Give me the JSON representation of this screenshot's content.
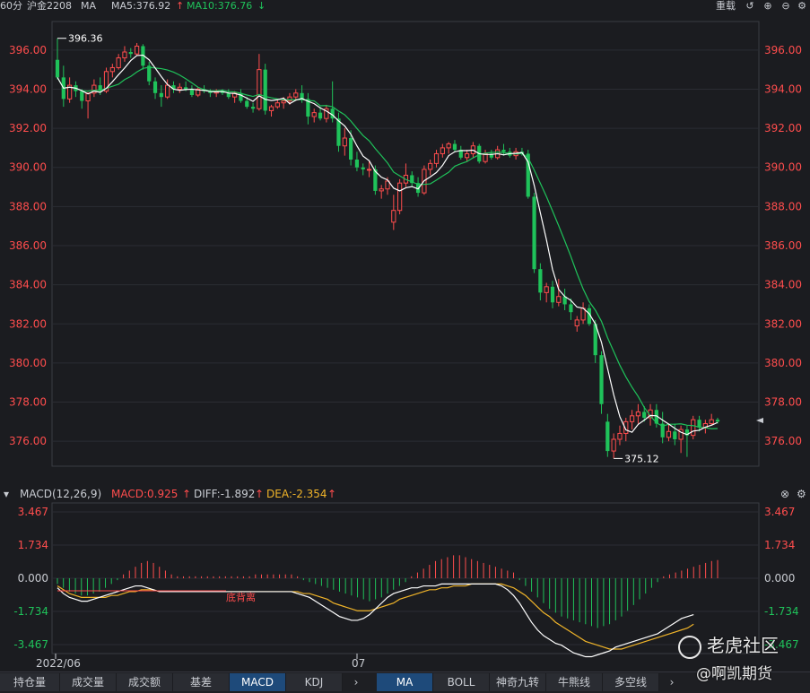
{
  "header": {
    "interval": "60分",
    "symbol": "沪金2208",
    "indicator": "MA",
    "ma5": "MA5:376.92",
    "ma10": "MA10:376.76",
    "reset_label": "重载"
  },
  "price_axis": [
    "396.00",
    "394.00",
    "392.00",
    "390.00",
    "388.00",
    "386.00",
    "384.00",
    "382.00",
    "380.00",
    "378.00",
    "376.00"
  ],
  "annotations": {
    "high": "396.36",
    "low": "375.12"
  },
  "macd_header": {
    "name": "MACD(12,26,9)",
    "macd": "MACD:0.925",
    "diff": "DIFF:-1.892",
    "dea": "DEA:-2.354"
  },
  "macd_axis": [
    "3.467",
    "1.734",
    "0.000",
    "-1.734",
    "-3.467"
  ],
  "macd_annotation": "底背离",
  "time_axis": [
    "2022/06",
    "07"
  ],
  "tabs_left": [
    "持仓量",
    "成交量",
    "成交额",
    "基差",
    "MACD",
    "KDJ"
  ],
  "tabs_right": [
    "MA",
    "BOLL",
    "神奇九转",
    "牛熊线",
    "多空线"
  ],
  "active_left": "MACD",
  "active_right": "MA",
  "watermark": {
    "brand": "老虎社区",
    "weibo": "@啊凯期货"
  },
  "colors": {
    "up": "#ff4d4d",
    "down": "#1fc25a",
    "ma5": "#ffffff",
    "ma10": "#1fc25a",
    "dea": "#f0b429",
    "accent": "#1e4a7a"
  },
  "chart_data": [
    {
      "type": "candlestick",
      "title": "沪金2208 60分",
      "ylim": [
        375.0,
        397.0
      ],
      "grid": true,
      "series": [
        {
          "name": "candles",
          "values": [
            [
              395.5,
              396.6,
              394.5,
              394.6
            ],
            [
              394.6,
              395.2,
              393.1,
              393.5
            ],
            [
              393.5,
              394.6,
              393.3,
              394.2
            ],
            [
              394.2,
              394.4,
              393.6,
              393.9
            ],
            [
              393.9,
              394.0,
              393.0,
              393.4
            ],
            [
              393.4,
              393.8,
              392.5,
              393.8
            ],
            [
              393.8,
              394.5,
              393.6,
              394.2
            ],
            [
              394.2,
              394.6,
              393.7,
              393.9
            ],
            [
              393.9,
              395.1,
              393.8,
              394.9
            ],
            [
              394.9,
              395.3,
              394.6,
              395.1
            ],
            [
              395.1,
              395.8,
              395.0,
              395.6
            ],
            [
              395.6,
              396.2,
              395.4,
              395.9
            ],
            [
              395.9,
              396.1,
              395.6,
              395.8
            ],
            [
              395.8,
              396.36,
              395.7,
              396.2
            ],
            [
              396.2,
              396.3,
              395.0,
              395.2
            ],
            [
              395.2,
              395.4,
              394.2,
              394.4
            ],
            [
              394.4,
              394.6,
              393.5,
              393.8
            ],
            [
              393.8,
              394.2,
              393.1,
              393.6
            ],
            [
              393.6,
              394.5,
              393.5,
              394.2
            ],
            [
              394.2,
              394.4,
              393.8,
              394.0
            ],
            [
              394.0,
              394.3,
              393.8,
              394.1
            ],
            [
              394.1,
              394.4,
              393.9,
              394.0
            ],
            [
              394.0,
              394.2,
              393.6,
              393.7
            ],
            [
              393.7,
              394.1,
              393.6,
              394.0
            ],
            [
              394.0,
              394.2,
              393.8,
              393.9
            ],
            [
              393.9,
              394.0,
              393.6,
              393.8
            ],
            [
              393.8,
              394.0,
              393.6,
              393.9
            ],
            [
              393.9,
              394.0,
              393.7,
              393.8
            ],
            [
              393.8,
              394.0,
              393.5,
              393.6
            ],
            [
              393.6,
              393.9,
              393.3,
              393.8
            ],
            [
              393.8,
              394.0,
              393.3,
              393.4
            ],
            [
              393.4,
              393.6,
              393.0,
              393.1
            ],
            [
              393.1,
              393.3,
              392.8,
              393.0
            ],
            [
              393.0,
              395.8,
              392.9,
              395.0
            ],
            [
              395.0,
              395.3,
              392.7,
              392.9
            ],
            [
              392.9,
              393.2,
              392.6,
              393.1
            ],
            [
              393.1,
              393.5,
              393.0,
              393.3
            ],
            [
              393.3,
              393.6,
              393.0,
              393.4
            ],
            [
              393.4,
              393.8,
              393.2,
              393.6
            ],
            [
              393.6,
              394.0,
              393.4,
              393.8
            ],
            [
              393.8,
              394.2,
              393.3,
              393.5
            ],
            [
              393.5,
              393.8,
              392.2,
              392.6
            ],
            [
              392.6,
              393.0,
              392.3,
              392.8
            ],
            [
              392.8,
              393.1,
              392.4,
              392.5
            ],
            [
              392.5,
              393.2,
              392.3,
              393.0
            ],
            [
              393.0,
              394.4,
              392.3,
              392.5
            ],
            [
              392.5,
              392.8,
              390.8,
              391.1
            ],
            [
              391.1,
              392.0,
              390.6,
              391.5
            ],
            [
              391.5,
              391.9,
              390.1,
              390.4
            ],
            [
              390.4,
              390.8,
              389.8,
              390.0
            ],
            [
              390.0,
              390.2,
              389.6,
              389.9
            ],
            [
              389.9,
              390.3,
              389.5,
              389.9
            ],
            [
              389.9,
              390.1,
              388.6,
              388.8
            ],
            [
              388.8,
              389.1,
              388.4,
              388.9
            ],
            [
              388.9,
              389.5,
              388.6,
              389.3
            ],
            [
              387.2,
              388.6,
              386.8,
              387.8
            ],
            [
              387.8,
              389.4,
              387.6,
              389.2
            ],
            [
              389.2,
              390.2,
              389.0,
              389.6
            ],
            [
              389.6,
              389.8,
              389.0,
              389.2
            ],
            [
              389.2,
              389.5,
              388.5,
              388.7
            ],
            [
              388.7,
              390.1,
              388.6,
              389.9
            ],
            [
              389.9,
              390.4,
              389.6,
              390.2
            ],
            [
              390.2,
              390.9,
              390.0,
              390.7
            ],
            [
              390.7,
              391.2,
              390.5,
              391.0
            ],
            [
              391.0,
              391.3,
              390.7,
              391.2
            ],
            [
              391.2,
              391.4,
              390.8,
              390.9
            ],
            [
              390.9,
              391.1,
              390.4,
              390.5
            ],
            [
              390.5,
              390.9,
              390.3,
              390.7
            ],
            [
              390.7,
              391.3,
              390.5,
              391.1
            ],
            [
              391.1,
              391.2,
              390.2,
              390.3
            ],
            [
              390.3,
              390.9,
              390.2,
              390.7
            ],
            [
              390.7,
              390.9,
              390.4,
              390.5
            ],
            [
              390.5,
              391.1,
              390.4,
              390.9
            ],
            [
              390.9,
              391.2,
              390.6,
              390.8
            ],
            [
              390.8,
              391.0,
              390.5,
              390.6
            ],
            [
              390.6,
              391.0,
              390.4,
              390.8
            ],
            [
              390.8,
              391.0,
              390.6,
              390.7
            ],
            [
              390.7,
              390.9,
              388.4,
              388.5
            ],
            [
              388.5,
              388.7,
              384.6,
              384.8
            ],
            [
              384.8,
              385.1,
              383.2,
              383.6
            ],
            [
              383.6,
              384.1,
              383.1,
              383.9
            ],
            [
              383.9,
              384.2,
              382.8,
              383.1
            ],
            [
              383.1,
              384.3,
              382.9,
              383.4
            ],
            [
              383.4,
              383.8,
              382.7,
              383.0
            ],
            [
              383.0,
              383.3,
              382.2,
              382.6
            ],
            [
              381.9,
              382.4,
              381.6,
              382.2
            ],
            [
              382.2,
              383.1,
              382.0,
              382.8
            ],
            [
              382.8,
              383.0,
              381.9,
              382.0
            ],
            [
              382.0,
              382.2,
              380.0,
              380.4
            ],
            [
              380.4,
              380.6,
              377.4,
              377.9
            ],
            [
              377.0,
              377.4,
              375.2,
              375.5
            ],
            [
              375.5,
              376.4,
              375.12,
              376.1
            ],
            [
              376.1,
              376.8,
              375.8,
              376.4
            ],
            [
              376.4,
              377.2,
              376.0,
              377.0
            ],
            [
              377.0,
              377.6,
              376.6,
              377.3
            ],
            [
              377.3,
              377.9,
              376.9,
              377.5
            ],
            [
              377.5,
              377.8,
              377.0,
              377.2
            ],
            [
              377.2,
              377.9,
              376.8,
              377.6
            ],
            [
              377.6,
              377.9,
              376.7,
              376.9
            ],
            [
              376.9,
              377.5,
              375.9,
              376.2
            ],
            [
              376.2,
              376.9,
              376.0,
              376.5
            ],
            [
              376.5,
              376.9,
              375.8,
              376.1
            ],
            [
              376.1,
              376.8,
              375.4,
              376.6
            ],
            [
              376.6,
              376.8,
              375.2,
              376.3
            ],
            [
              376.3,
              377.3,
              376.1,
              377.1
            ],
            [
              377.1,
              377.3,
              376.5,
              376.7
            ],
            [
              376.7,
              377.1,
              376.4,
              376.9
            ],
            [
              376.9,
              377.4,
              376.8,
              377.1
            ],
            [
              377.1,
              377.2,
              376.9,
              377.0
            ]
          ]
        }
      ]
    },
    {
      "type": "bar",
      "title": "MACD(12,26,9)",
      "ylim": [
        -3.467,
        3.467
      ],
      "series": [
        {
          "name": "MACD",
          "values": [
            -0.3,
            -0.5,
            -0.7,
            -0.8,
            -0.9,
            -0.9,
            -0.8,
            -0.7,
            -0.5,
            -0.3,
            -0.1,
            0.2,
            0.4,
            0.6,
            0.8,
            0.9,
            0.8,
            0.6,
            0.4,
            0.2,
            0.1,
            0.1,
            0.1,
            0.1,
            0.1,
            0.1,
            0.1,
            0.1,
            0.1,
            0.1,
            0.1,
            0.1,
            0.1,
            0.2,
            0.2,
            0.2,
            0.2,
            0.2,
            0.2,
            0.2,
            0.1,
            -0.1,
            -0.2,
            -0.3,
            -0.4,
            -0.5,
            -0.6,
            -0.7,
            -0.8,
            -0.9,
            -1.0,
            -1.1,
            -1.2,
            -1.1,
            -1.0,
            -0.8,
            -0.6,
            -0.4,
            -0.2,
            0.1,
            0.3,
            0.5,
            0.7,
            0.9,
            1.0,
            1.1,
            1.2,
            1.2,
            1.1,
            1.0,
            0.9,
            0.8,
            0.7,
            0.6,
            0.5,
            0.4,
            0.3,
            -0.1,
            -0.4,
            -0.7,
            -1.0,
            -1.3,
            -1.6,
            -1.8,
            -2.0,
            -2.1,
            -2.2,
            -2.3,
            -2.4,
            -2.5,
            -2.6,
            -2.5,
            -2.4,
            -2.2,
            -2.0,
            -1.7,
            -1.4,
            -1.1,
            -0.8,
            -0.5,
            -0.2,
            0.1,
            0.2,
            0.3,
            0.4,
            0.5,
            0.6,
            0.7,
            0.8,
            0.9,
            0.95
          ]
        },
        {
          "name": "DIFF",
          "values": [
            -0.5,
            -0.8,
            -1.0,
            -1.1,
            -1.2,
            -1.2,
            -1.1,
            -1.0,
            -0.9,
            -0.8,
            -0.7,
            -0.6,
            -0.5,
            -0.4,
            -0.4,
            -0.5,
            -0.6,
            -0.7,
            -0.7,
            -0.7,
            -0.7,
            -0.7,
            -0.7,
            -0.7,
            -0.7,
            -0.7,
            -0.7,
            -0.7,
            -0.7,
            -0.7,
            -0.7,
            -0.7,
            -0.7,
            -0.7,
            -0.7,
            -0.7,
            -0.7,
            -0.7,
            -0.7,
            -0.7,
            -0.8,
            -0.9,
            -1.0,
            -1.2,
            -1.4,
            -1.6,
            -1.8,
            -2.0,
            -2.1,
            -2.2,
            -2.2,
            -2.1,
            -1.9,
            -1.6,
            -1.3,
            -1.0,
            -0.8,
            -0.7,
            -0.6,
            -0.5,
            -0.5,
            -0.4,
            -0.4,
            -0.4,
            -0.3,
            -0.3,
            -0.3,
            -0.3,
            -0.3,
            -0.3,
            -0.3,
            -0.3,
            -0.3,
            -0.3,
            -0.4,
            -0.6,
            -0.9,
            -1.3,
            -1.8,
            -2.3,
            -2.7,
            -3.0,
            -3.2,
            -3.4,
            -3.5,
            -3.7,
            -3.9,
            -4.0,
            -4.1,
            -4.1,
            -4.0,
            -3.9,
            -3.8,
            -3.6,
            -3.5,
            -3.4,
            -3.3,
            -3.2,
            -3.1,
            -3.0,
            -2.9,
            -2.7,
            -2.5,
            -2.3,
            -2.1,
            -2.0,
            -1.9
          ]
        },
        {
          "name": "DEA",
          "values": [
            -0.4,
            -0.6,
            -0.8,
            -0.9,
            -1.0,
            -1.0,
            -1.0,
            -1.0,
            -1.0,
            -0.9,
            -0.9,
            -0.8,
            -0.7,
            -0.7,
            -0.6,
            -0.6,
            -0.6,
            -0.7,
            -0.7,
            -0.7,
            -0.7,
            -0.7,
            -0.7,
            -0.7,
            -0.7,
            -0.7,
            -0.7,
            -0.7,
            -0.7,
            -0.7,
            -0.7,
            -0.7,
            -0.7,
            -0.7,
            -0.7,
            -0.7,
            -0.7,
            -0.7,
            -0.7,
            -0.7,
            -0.7,
            -0.8,
            -0.8,
            -0.9,
            -1.0,
            -1.1,
            -1.3,
            -1.4,
            -1.5,
            -1.6,
            -1.7,
            -1.7,
            -1.7,
            -1.6,
            -1.5,
            -1.4,
            -1.3,
            -1.1,
            -1.0,
            -0.9,
            -0.8,
            -0.7,
            -0.6,
            -0.6,
            -0.5,
            -0.5,
            -0.4,
            -0.4,
            -0.4,
            -0.3,
            -0.3,
            -0.3,
            -0.3,
            -0.3,
            -0.3,
            -0.4,
            -0.5,
            -0.7,
            -0.9,
            -1.2,
            -1.5,
            -1.8,
            -2.0,
            -2.3,
            -2.5,
            -2.7,
            -2.9,
            -3.1,
            -3.3,
            -3.4,
            -3.5,
            -3.6,
            -3.7,
            -3.7,
            -3.7,
            -3.6,
            -3.5,
            -3.4,
            -3.3,
            -3.2,
            -3.1,
            -3.0,
            -2.9,
            -2.8,
            -2.7,
            -2.6,
            -2.4
          ]
        }
      ]
    }
  ]
}
